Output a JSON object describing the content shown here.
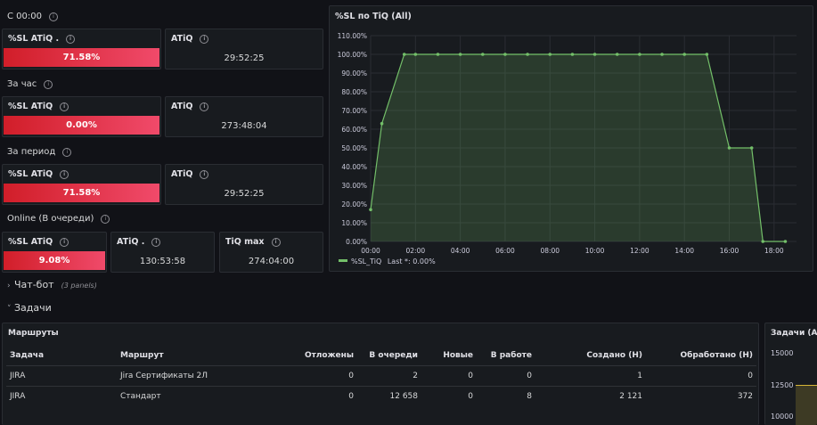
{
  "groups": [
    {
      "title": "С 00:00",
      "stats": [
        {
          "title": "%SL ATiQ .",
          "value": "71.58%",
          "kind": "bar"
        },
        {
          "title": "ATiQ",
          "value": "29:52:25",
          "kind": "text"
        }
      ]
    },
    {
      "title": "За час",
      "stats": [
        {
          "title": "%SL ATiQ",
          "value": "0.00%",
          "kind": "bar"
        },
        {
          "title": "ATiQ",
          "value": "273:48:04",
          "kind": "text"
        }
      ]
    },
    {
      "title": "За период",
      "stats": [
        {
          "title": "%SL ATiQ",
          "value": "71.58%",
          "kind": "bar"
        },
        {
          "title": "ATiQ",
          "value": "29:52:25",
          "kind": "text"
        }
      ]
    },
    {
      "title": "Online (В очереди)",
      "stats": [
        {
          "title": "%SL ATiQ",
          "value": "9.08%",
          "kind": "bar"
        },
        {
          "title": "ATiQ .",
          "value": "130:53:58",
          "kind": "text"
        },
        {
          "title": "TiQ max",
          "value": "274:04:00",
          "kind": "text"
        }
      ]
    }
  ],
  "chart_panel": {
    "title": "%SL по TiQ (All)",
    "legend_label": "%SL_TiQ",
    "legend_last": "Last *: 0.00%"
  },
  "chart_data": {
    "type": "area",
    "title": "%SL по TiQ (All)",
    "x": [
      "00:00",
      "00:30",
      "01:30",
      "02:00",
      "03:00",
      "04:00",
      "05:00",
      "06:00",
      "07:00",
      "08:00",
      "09:00",
      "10:00",
      "11:00",
      "12:00",
      "13:00",
      "14:00",
      "15:00",
      "16:00",
      "17:00",
      "17:30",
      "18:30"
    ],
    "x_minutes": [
      0,
      30,
      90,
      120,
      180,
      240,
      300,
      360,
      420,
      480,
      540,
      600,
      660,
      720,
      780,
      840,
      900,
      960,
      1020,
      1050,
      1110
    ],
    "series": [
      {
        "name": "%SL_TiQ",
        "values": [
          17,
          63,
          100,
          100,
          100,
          100,
          100,
          100,
          100,
          100,
          100,
          100,
          100,
          100,
          100,
          100,
          100,
          50,
          50,
          0,
          0
        ]
      }
    ],
    "xticks": [
      "00:00",
      "02:00",
      "04:00",
      "06:00",
      "08:00",
      "10:00",
      "12:00",
      "14:00",
      "16:00",
      "18:00"
    ],
    "yticks": [
      "0.00%",
      "10.00%",
      "20.00%",
      "30.00%",
      "40.00%",
      "50.00%",
      "60.00%",
      "70.00%",
      "80.00%",
      "90.00%",
      "100.00%",
      "110.00%"
    ],
    "ylim": [
      0,
      110
    ],
    "color": "#73bf69"
  },
  "sections": {
    "chatbot": {
      "label": "Чат-бот",
      "count": "(3 panels)"
    },
    "tasks": {
      "label": "Задачи"
    }
  },
  "routes": {
    "title": "Маршруты",
    "columns": [
      "Задача",
      "Маршрут",
      "Отложены",
      "В очереди",
      "Новые",
      "В работе",
      "Создано (Н)",
      "Обработано (Н)"
    ],
    "rows": [
      [
        "JIRA",
        "Jira Сертификаты 2Л",
        "0",
        "2",
        "0",
        "0",
        "1",
        "0"
      ],
      [
        "JIRA",
        "Стандарт",
        "0",
        "12 658",
        "0",
        "8",
        "2 121",
        "372"
      ]
    ]
  },
  "tasks_panel": {
    "title": "Задачи (All",
    "yticks": [
      "15000",
      "12500",
      "10000"
    ]
  },
  "colors": {
    "bar_start": "#d11e29",
    "bar_end": "#f04a6a",
    "series": "#73bf69",
    "background": "#111217",
    "panel": "#181b1f"
  }
}
